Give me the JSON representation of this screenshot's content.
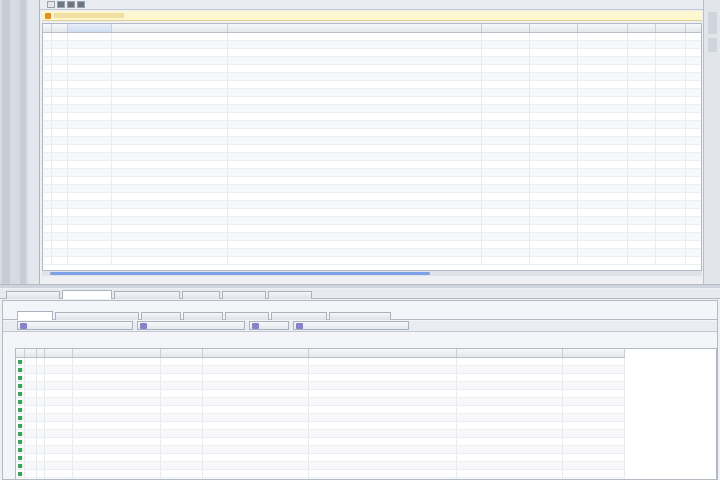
{
  "colors": {
    "accent": "#3b6fd8",
    "info_bg": "#fff7cf",
    "ok_mark": "#34a853",
    "warn_icon": "#f08c1a"
  },
  "toolbar": {
    "buttons": [
      "close-icon",
      "document-icon",
      "refresh-icon",
      "save-icon"
    ]
  },
  "infobar": {
    "text": ""
  },
  "top_grid": {
    "columns": [
      "",
      "",
      "",
      "",
      "",
      "",
      "",
      "",
      "",
      "",
      "",
      ""
    ],
    "rows": [
      [
        "",
        "",
        "",
        "",
        "",
        "",
        "",
        "",
        "",
        "",
        ""
      ],
      [
        "",
        "",
        "",
        "",
        "",
        "",
        "",
        "",
        "",
        "",
        ""
      ],
      [
        "",
        "",
        "",
        "",
        "",
        "",
        "",
        "",
        "",
        "",
        ""
      ],
      [
        "",
        "",
        "",
        "",
        "",
        "",
        "",
        "",
        "",
        "",
        ""
      ],
      [
        "",
        "",
        "",
        "",
        "",
        "",
        "",
        "",
        "",
        "",
        ""
      ],
      [
        "",
        "",
        "",
        "",
        "",
        "",
        "",
        "",
        "",
        "",
        ""
      ],
      [
        "",
        "",
        "",
        "",
        "",
        "",
        "",
        "",
        "",
        "",
        ""
      ],
      [
        "",
        "",
        "",
        "",
        "",
        "",
        "",
        "",
        "",
        "",
        ""
      ],
      [
        "",
        "",
        "",
        "",
        "",
        "",
        "",
        "",
        "",
        "",
        ""
      ],
      [
        "",
        "",
        "",
        "",
        "",
        "",
        "",
        "",
        "",
        "",
        ""
      ],
      [
        "",
        "",
        "",
        "",
        "",
        "",
        "",
        "",
        "",
        "",
        ""
      ],
      [
        "",
        "",
        "",
        "",
        "",
        "",
        "",
        "",
        "",
        "",
        ""
      ],
      [
        "",
        "",
        "",
        "",
        "",
        "",
        "",
        "",
        "",
        "",
        ""
      ],
      [
        "",
        "",
        "",
        "",
        "",
        "",
        "",
        "",
        "",
        "",
        ""
      ],
      [
        "",
        "",
        "",
        "",
        "",
        "",
        "",
        "",
        "",
        "",
        ""
      ],
      [
        "",
        "",
        "",
        "",
        "",
        "",
        "",
        "",
        "",
        "",
        ""
      ],
      [
        "",
        "",
        "",
        "",
        "",
        "",
        "",
        "",
        "",
        "",
        ""
      ],
      [
        "",
        "",
        "",
        "",
        "",
        "",
        "",
        "",
        "",
        "",
        ""
      ],
      [
        "",
        "",
        "",
        "",
        "",
        "",
        "",
        "",
        "",
        "",
        ""
      ],
      [
        "",
        "",
        "",
        "",
        "",
        "",
        "",
        "",
        "",
        "",
        ""
      ],
      [
        "",
        "",
        "",
        "",
        "",
        "",
        "",
        "",
        "",
        "",
        ""
      ],
      [
        "",
        "",
        "",
        "",
        "",
        "",
        "",
        "",
        "",
        "",
        ""
      ],
      [
        "",
        "",
        "",
        "",
        "",
        "",
        "",
        "",
        "",
        "",
        ""
      ],
      [
        "",
        "",
        "",
        "",
        "",
        "",
        "",
        "",
        "",
        "",
        ""
      ],
      [
        "",
        "",
        "",
        "",
        "",
        "",
        "",
        "",
        "",
        "",
        ""
      ],
      [
        "",
        "",
        "",
        "",
        "",
        "",
        "",
        "",
        "",
        "",
        ""
      ],
      [
        "",
        "",
        "",
        "",
        "",
        "",
        "",
        "",
        "",
        "",
        ""
      ],
      [
        "",
        "",
        "",
        "",
        "",
        "",
        "",
        "",
        "",
        "",
        ""
      ],
      [
        "",
        "",
        "",
        "",
        "",
        "",
        "",
        "",
        "",
        "",
        ""
      ]
    ]
  },
  "main_tabs": [
    "",
    "",
    "",
    "",
    "",
    "",
    ""
  ],
  "sub_tabs": [
    "",
    "",
    "",
    "",
    "",
    "",
    "",
    ""
  ],
  "actions": [
    "",
    "",
    "",
    ""
  ],
  "bottom_grid": {
    "columns": [
      "",
      "",
      "",
      "",
      "",
      "",
      "",
      "",
      "",
      ""
    ],
    "rows": [
      [
        "",
        "",
        "",
        "",
        "",
        "",
        "",
        "",
        ""
      ],
      [
        "",
        "",
        "",
        "",
        "",
        "",
        "",
        "",
        ""
      ],
      [
        "",
        "",
        "",
        "",
        "",
        "",
        "",
        "",
        ""
      ],
      [
        "",
        "",
        "",
        "",
        "",
        "",
        "",
        "",
        ""
      ],
      [
        "",
        "",
        "",
        "",
        "",
        "",
        "",
        "",
        ""
      ],
      [
        "",
        "",
        "",
        "",
        "",
        "",
        "",
        "",
        ""
      ],
      [
        "",
        "",
        "",
        "",
        "",
        "",
        "",
        "",
        ""
      ],
      [
        "",
        "",
        "",
        "",
        "",
        "",
        "",
        "",
        ""
      ],
      [
        "",
        "",
        "",
        "",
        "",
        "",
        "",
        "",
        ""
      ],
      [
        "",
        "",
        "",
        "",
        "",
        "",
        "",
        "",
        ""
      ],
      [
        "",
        "",
        "",
        "",
        "",
        "",
        "",
        "",
        ""
      ],
      [
        "",
        "",
        "",
        "",
        "",
        "",
        "",
        "",
        ""
      ],
      [
        "",
        "",
        "",
        "",
        "",
        "",
        "",
        "",
        ""
      ],
      [
        "",
        "",
        "",
        "",
        "",
        "",
        "",
        "",
        ""
      ],
      [
        "",
        "",
        "",
        "",
        "",
        "",
        "",
        "",
        ""
      ],
      [
        "",
        "",
        "",
        "",
        "",
        "",
        "",
        "",
        ""
      ]
    ]
  }
}
